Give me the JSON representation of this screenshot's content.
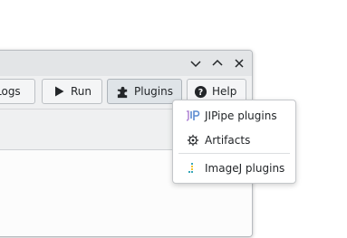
{
  "window": {
    "controls": [
      {
        "name": "minimize",
        "icon": "chevron-down-icon"
      },
      {
        "name": "maximize",
        "icon": "chevron-up-icon"
      },
      {
        "name": "close",
        "icon": "close-icon"
      }
    ]
  },
  "toolbar": {
    "logs_label": "Logs",
    "run_label": "Run",
    "plugins_label": "Plugins",
    "help_label": "Help"
  },
  "plugins_menu": {
    "items": [
      {
        "label": "JIPipe plugins",
        "icon": "jipipe-icon"
      },
      {
        "label": "Artifacts",
        "icon": "artifacts-gear-icon"
      },
      {
        "label": "ImageJ plugins",
        "icon": "imagej-icon"
      }
    ]
  },
  "colors": {
    "accent": "#3daee9",
    "jipipe_blue": "#5b8bd0",
    "jipipe_purple": "#b38ad6",
    "imagej_yellow": "#f1c232",
    "imagej_teal": "#36a6b8"
  }
}
